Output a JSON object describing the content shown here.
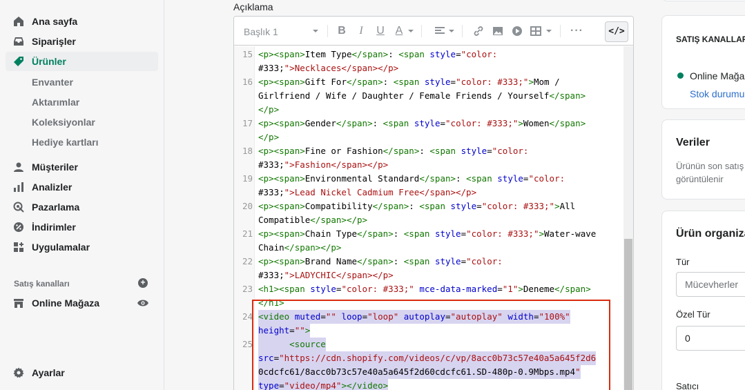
{
  "sidebar": {
    "items": [
      {
        "label": "Ana sayfa",
        "icon": "home-icon"
      },
      {
        "label": "Siparişler",
        "icon": "orders-icon"
      },
      {
        "label": "Ürünler",
        "icon": "tag-icon",
        "active": true
      },
      {
        "label": "Müşteriler",
        "icon": "person-icon"
      },
      {
        "label": "Analizler",
        "icon": "bar-chart-icon"
      },
      {
        "label": "Pazarlama",
        "icon": "target-icon"
      },
      {
        "label": "İndirimler",
        "icon": "discount-icon"
      },
      {
        "label": "Uygulamalar",
        "icon": "apps-icon"
      }
    ],
    "product_subitems": [
      "Envanter",
      "Aktarımlar",
      "Koleksiyonlar",
      "Hediye kartları"
    ],
    "sales_channels_label": "Satış kanalları",
    "online_store": "Online Mağaza",
    "settings": "Ayarlar"
  },
  "editor": {
    "label": "Açıklama",
    "heading_select": "Başlık 1",
    "code_button": "</>",
    "lines": [
      {
        "n": "15",
        "text": "<p><span>Item Type</span>: <span style=\"color:"
      },
      {
        "n": "",
        "text": "#333;\">Necklaces</span></p>"
      },
      {
        "n": "16",
        "text": "<p><span>Gift For</span>: <span style=\"color: #333;\">Mom /"
      },
      {
        "n": "",
        "text": "Girlfriend / Wife / Daughter / Female Friends / Yourself</span>"
      },
      {
        "n": "",
        "text": "</p>"
      },
      {
        "n": "17",
        "text": "<p><span>Gender</span>: <span style=\"color: #333;\">Women</span>"
      },
      {
        "n": "",
        "text": "</p>"
      },
      {
        "n": "18",
        "text": "<p><span>Fine or Fashion</span>: <span style=\"color:"
      },
      {
        "n": "",
        "text": "#333;\">Fashion</span></p>"
      },
      {
        "n": "19",
        "text": "<p><span>Environmental Standard</span>: <span style=\"color:"
      },
      {
        "n": "",
        "text": "#333;\">Lead Nickel Cadmium Free</span></p>"
      },
      {
        "n": "20",
        "text": "<p><span>Compatibility</span>: <span style=\"color: #333;\">All"
      },
      {
        "n": "",
        "text": "Compatible</span></p>"
      },
      {
        "n": "21",
        "text": "<p><span>Chain Type</span>: <span style=\"color: #333;\">Water-wave"
      },
      {
        "n": "",
        "text": "Chain</span></p>"
      },
      {
        "n": "22",
        "text": "<p><span>Brand Name</span>: <span style=\"color:"
      },
      {
        "n": "",
        "text": "#333;\">LADYCHIC</span></p>"
      },
      {
        "n": "23",
        "text": "<h1><span style=\"color: #333;\" mce-data-marked=\"1\">Deneme</span>"
      },
      {
        "n": "",
        "text": "</h1>"
      },
      {
        "n": "24",
        "text": "<video muted=\"\" loop=\"loop\" autoplay=\"autoplay\" width=\"100%\"",
        "selected": true
      },
      {
        "n": "",
        "text": "height=\"\">",
        "selected": true
      },
      {
        "n": "25",
        "text": "      <source",
        "selected": true
      },
      {
        "n": "",
        "text": "src=\"https://cdn.shopify.com/videos/c/vp/8acc0b73c57e40a5a645f2d6",
        "selected": true
      },
      {
        "n": "",
        "text": "0cdcfc61/8acc0b73c57e40a5a645f2d60cdcfc61.SD-480p-0.9Mbps.mp4\"",
        "selected": true
      },
      {
        "n": "",
        "text": "type=\"video/mp4\"></video>",
        "selected": true
      }
    ]
  },
  "right": {
    "sales_channels_title": "SATIŞ KANALLARI",
    "online_store": "Online Mağaz",
    "stock_link": "Stok durumu",
    "data_title": "Veriler",
    "data_text_1": "Ürünün son satış",
    "data_text_2": "görüntülenir",
    "org_title": "Ürün organiza",
    "type_label": "Tür",
    "type_value": "Mücevherler",
    "custom_type_label": "Özel Tür",
    "custom_type_value": "0",
    "vendor_label": "Satıcı"
  },
  "colors": {
    "accent": "#008060",
    "highlight": "#d82c0d",
    "selection": "#d7d4f0"
  }
}
